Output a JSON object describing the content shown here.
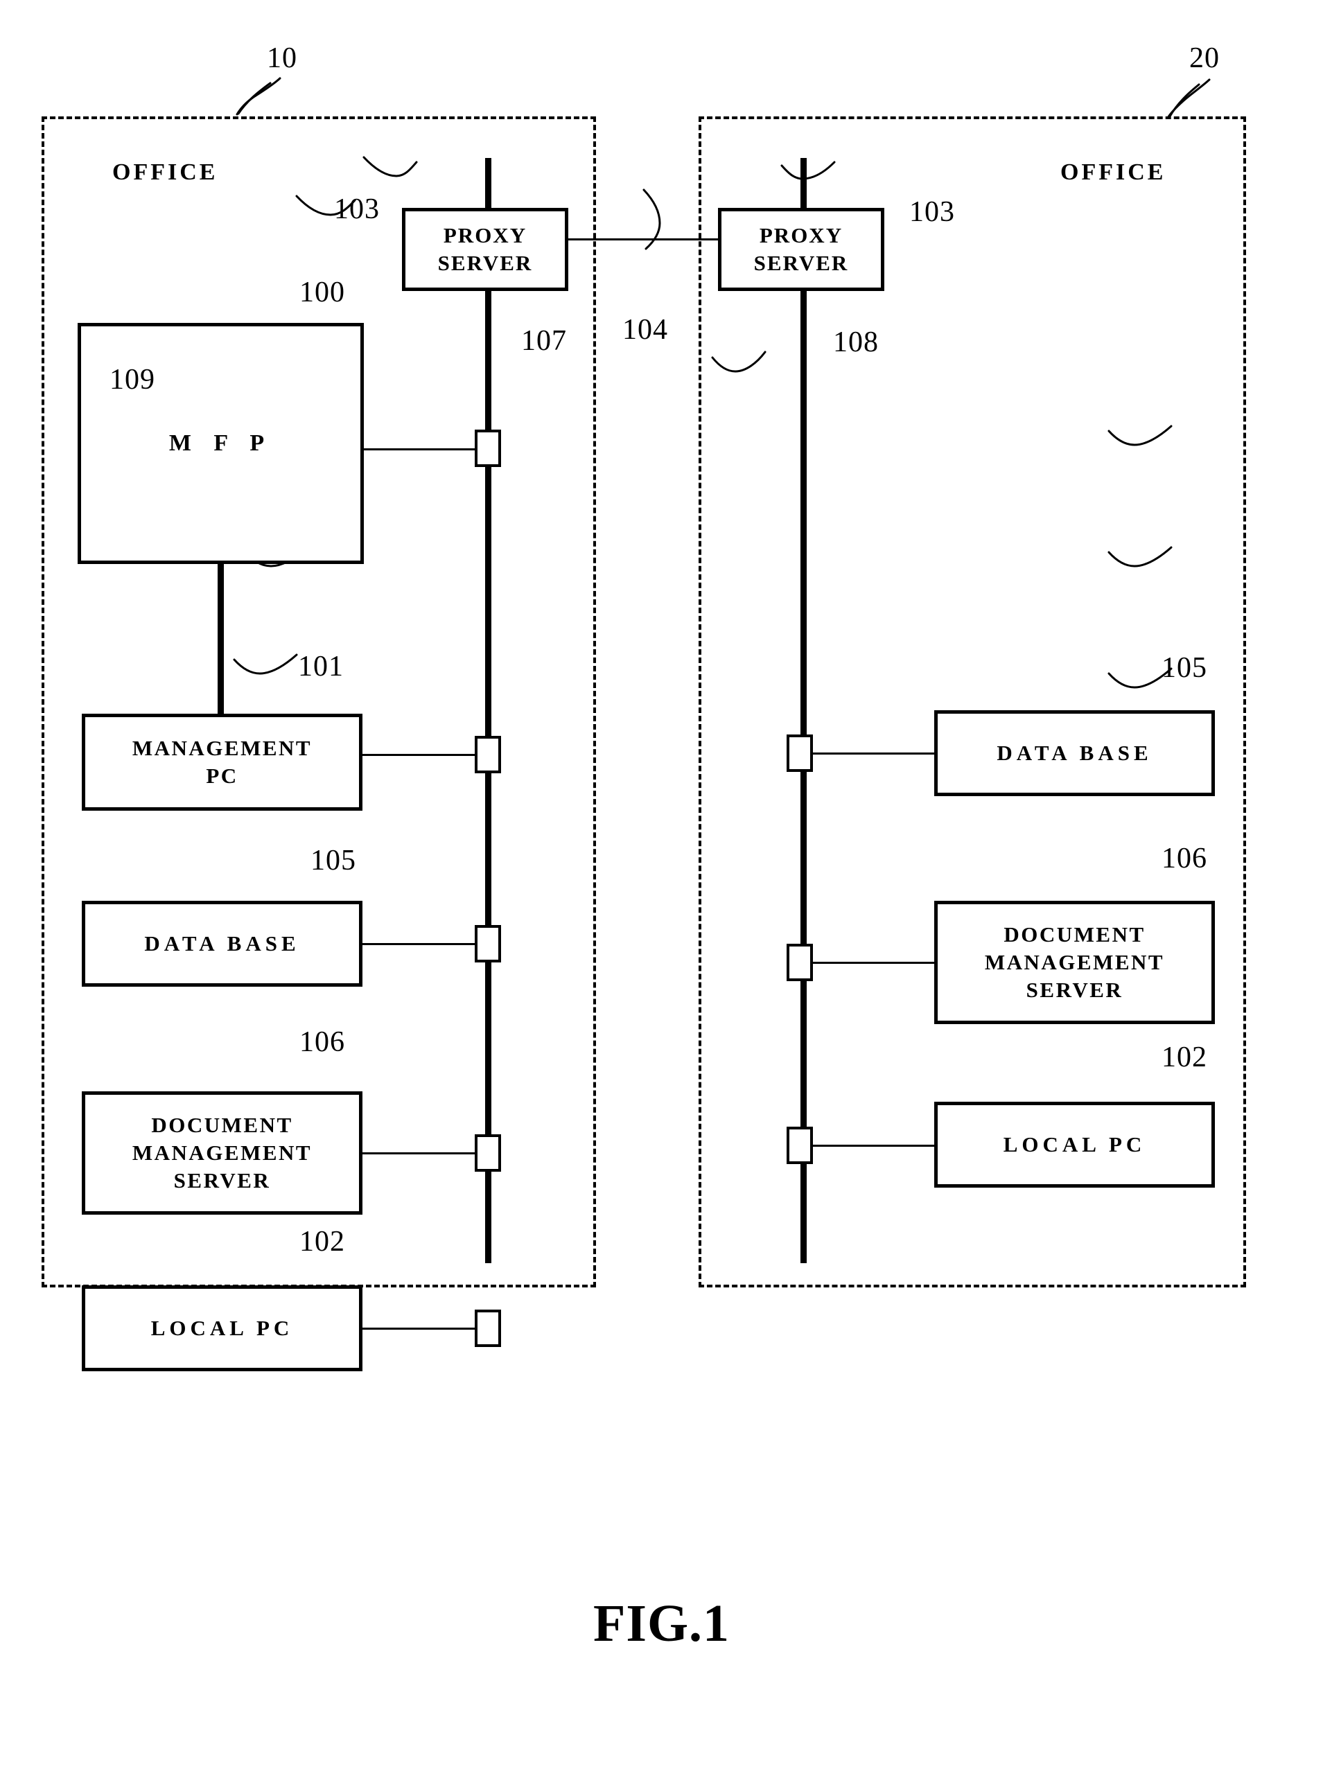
{
  "figure": {
    "caption": "FIG.1",
    "type": "patent-block-diagram"
  },
  "offices": [
    {
      "id": "office-left",
      "ref": "10",
      "label": "OFFICE",
      "bus_ref": "107",
      "nodes": [
        {
          "ref": "103",
          "label": "PROXY\nSERVER"
        },
        {
          "ref": "100",
          "label": "M F P"
        },
        {
          "ref": "101",
          "label": "MANAGEMENT\nPC"
        },
        {
          "ref": "105",
          "label": "DATA BASE"
        },
        {
          "ref": "106",
          "label": "DOCUMENT\nMANAGEMENT\nSERVER"
        },
        {
          "ref": "102",
          "label": "LOCAL PC"
        }
      ],
      "internal_link_ref": "109"
    },
    {
      "id": "office-right",
      "ref": "20",
      "label": "OFFICE",
      "bus_ref": "108",
      "nodes": [
        {
          "ref": "103",
          "label": "PROXY\nSERVER"
        },
        {
          "ref": "105",
          "label": "DATA BASE"
        },
        {
          "ref": "106",
          "label": "DOCUMENT\nMANAGEMENT\nSERVER"
        },
        {
          "ref": "102",
          "label": "LOCAL PC"
        }
      ]
    }
  ],
  "inter_office_link": {
    "ref": "104",
    "from": "PROXY SERVER",
    "to": "PROXY SERVER"
  },
  "refs": {
    "office_left": "10",
    "office_right": "20",
    "mfp": "100",
    "management_pc": "101",
    "local_pc": "102",
    "proxy_server": "103",
    "wan_link": "104",
    "data_base": "105",
    "document_management_server": "106",
    "lan_left": "107",
    "lan_right": "108",
    "mfp_pc_link": "109"
  },
  "labels": {
    "office": "OFFICE",
    "proxy_server": "PROXY\nSERVER",
    "mfp": "M F P",
    "management_pc": "MANAGEMENT\nPC",
    "data_base": "DATA BASE",
    "document_management_server": "DOCUMENT\nMANAGEMENT\nSERVER",
    "local_pc": "LOCAL PC"
  },
  "colors": {
    "ink": "#000000",
    "paper": "#ffffff"
  }
}
